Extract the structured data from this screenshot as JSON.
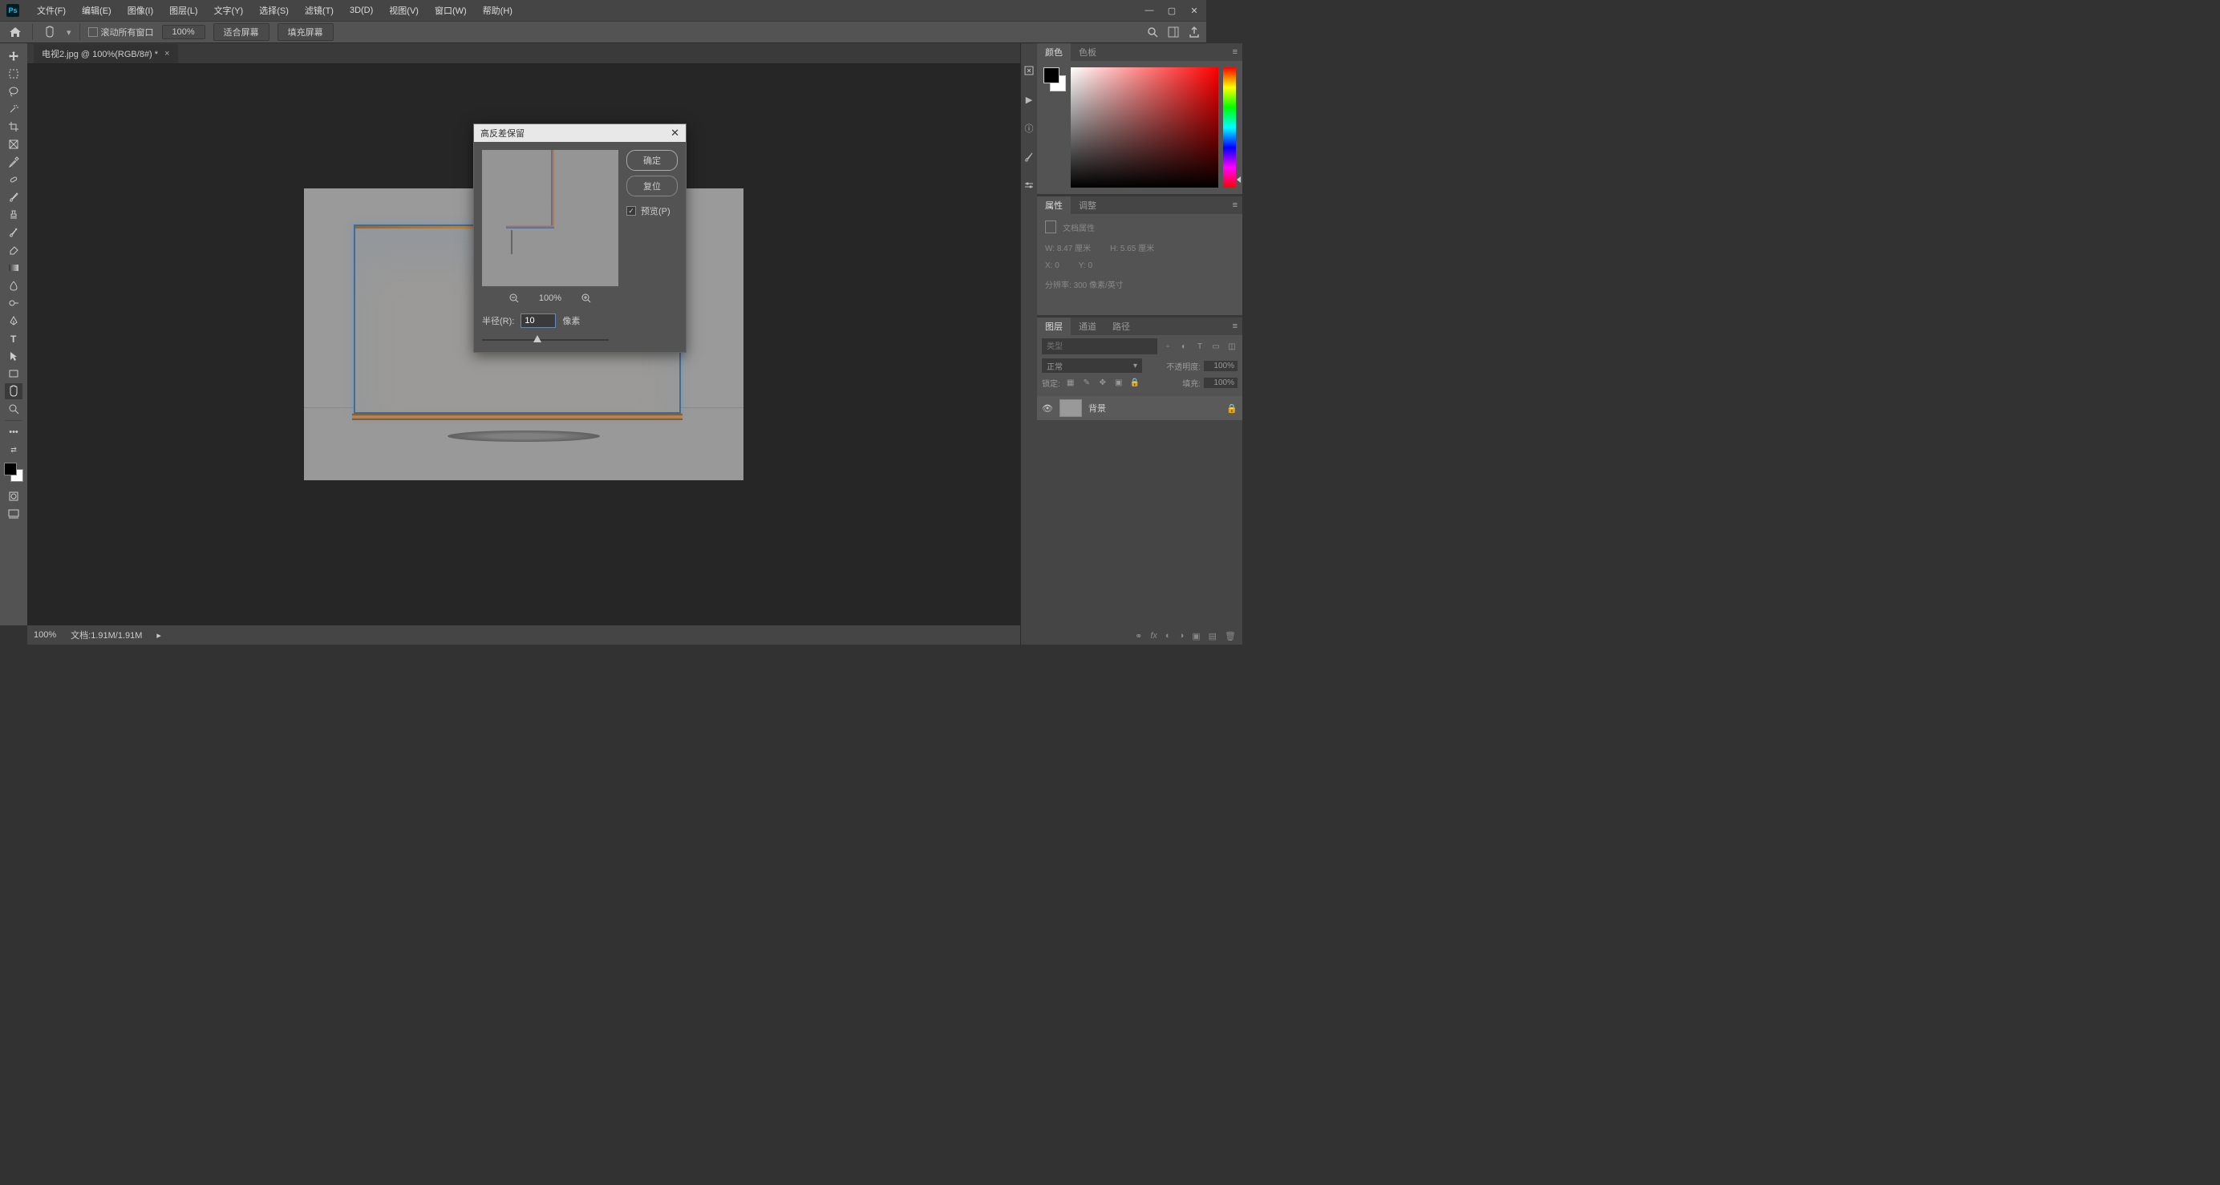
{
  "menubar": {
    "items": [
      "文件(F)",
      "编辑(E)",
      "图像(I)",
      "图层(L)",
      "文字(Y)",
      "选择(S)",
      "滤镜(T)",
      "3D(D)",
      "视图(V)",
      "窗口(W)",
      "帮助(H)"
    ]
  },
  "optionbar": {
    "scroll_all": "滚动所有窗口",
    "zoom": "100%",
    "fit": "适合屏幕",
    "fill": "填充屏幕"
  },
  "tab": {
    "title": "电视2.jpg @ 100%(RGB/8#) *"
  },
  "dialog": {
    "title": "高反差保留",
    "ok": "确定",
    "reset": "复位",
    "preview": "预览(P)",
    "zoom_pct": "100%",
    "radius_label": "半径(R):",
    "radius_value": "10",
    "radius_unit": "像素"
  },
  "panels": {
    "color": "颜色",
    "swatches": "色板",
    "properties": "属性",
    "adjustments": "调整",
    "doc_props": "文档属性",
    "w_label": "W:",
    "w_val": "8.47 厘米",
    "h_label": "H:",
    "h_val": "5.65 厘米",
    "x_label": "X:",
    "x_val": "0",
    "y_label": "Y:",
    "y_val": "0",
    "res_label": "分辨率:",
    "res_val": "300 像素/英寸",
    "layers": "图层",
    "channels": "通道",
    "paths": "路径",
    "kind": "类型",
    "normal": "正常",
    "opacity": "不透明度:",
    "opacity_val": "100%",
    "lock": "锁定:",
    "fill": "填充:",
    "fill_val": "100%",
    "bg_layer": "背景"
  },
  "status": {
    "zoom": "100%",
    "doc": "文档:1.91M/1.91M"
  }
}
